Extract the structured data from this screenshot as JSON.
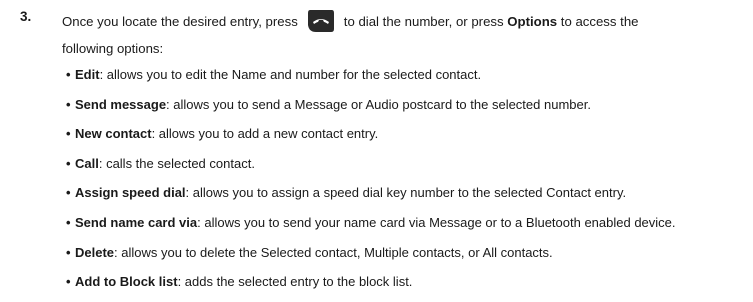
{
  "step": {
    "number": "3.",
    "text_before_icon": "Once you locate the desired entry, press",
    "icon": "call-send-key-icon",
    "text_after_icon": "to dial the number, or press",
    "options_label": "Options",
    "text_end": "to access the",
    "line2": "following options:"
  },
  "options": [
    {
      "term": "Edit",
      "desc": ": allows you to edit the Name and number for the selected contact."
    },
    {
      "term": "Send message",
      "desc": ": allows you to send a Message or Audio postcard to the selected number."
    },
    {
      "term": "New contact",
      "desc": ": allows you to add a new contact entry."
    },
    {
      "term": "Call",
      "desc": ": calls the selected contact."
    },
    {
      "term": "Assign speed dial",
      "desc": ": allows you to assign a speed dial key number to the selected Contact entry."
    },
    {
      "term": "Send name card via",
      "desc": ": allows you to send your name card via Message or to a Bluetooth enabled device."
    },
    {
      "term": "Delete",
      "desc": ": allows you to delete the Selected contact, Multiple contacts, or All contacts."
    },
    {
      "term": "Add to Block list",
      "desc": ": adds the selected entry to the block list."
    }
  ],
  "colors": {
    "text": "#1a1a1a",
    "key_fill": "#2a2a2a"
  }
}
